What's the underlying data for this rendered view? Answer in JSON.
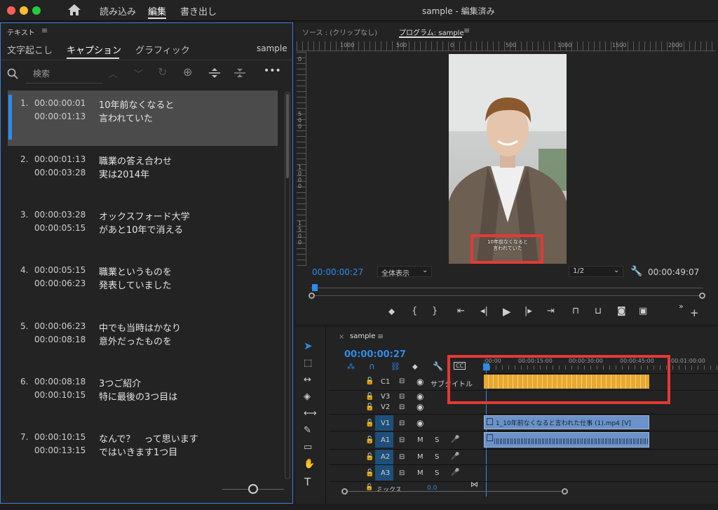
{
  "window": {
    "title": "sample - 編集済み"
  },
  "nav": {
    "import": "読み込み",
    "edit": "編集",
    "export": "書き出し"
  },
  "text_panel": {
    "title": "テキスト",
    "tabs": [
      "文字起こし",
      "キャプション",
      "グラフィック"
    ],
    "sequence": "sample",
    "search_placeholder": "検索",
    "captions": [
      {
        "num": "1.",
        "in": "00:00:00:01",
        "out": "00:00:01:13",
        "line1": "10年前なくなると",
        "line2": "言われていた"
      },
      {
        "num": "2.",
        "in": "00:00:01:13",
        "out": "00:00:03:28",
        "line1": "職業の答え合わせ",
        "line2": "実は2014年"
      },
      {
        "num": "3.",
        "in": "00:00:03:28",
        "out": "00:00:05:15",
        "line1": "オックスフォード大学",
        "line2": "があと10年で消える"
      },
      {
        "num": "4.",
        "in": "00:00:05:15",
        "out": "00:00:06:23",
        "line1": "職業というものを",
        "line2": "発表していました"
      },
      {
        "num": "5.",
        "in": "00:00:06:23",
        "out": "00:00:08:18",
        "line1": "中でも当時はかなり",
        "line2": "意外だったものを"
      },
      {
        "num": "6.",
        "in": "00:00:08:18",
        "out": "00:00:10:15",
        "line1": "3つご紹介",
        "line2": "特に最後の3つ目は"
      },
      {
        "num": "7.",
        "in": "00:00:10:15",
        "out": "00:00:13:15",
        "line1": "なんで？　って思います",
        "line2": "ではいきます1つ目"
      }
    ]
  },
  "monitor": {
    "source_tab": "ソース : (クリップなし)",
    "program_tab": "プログラム: sample",
    "ruler_labels": [
      "1000",
      "500",
      "0",
      "500",
      "1000",
      "1500",
      "2000"
    ],
    "vruler_labels": [
      "0",
      "500",
      "1000",
      "1500"
    ],
    "timecode": "00:00:00:27",
    "zoom": "全体表示",
    "quality": "1/2",
    "duration": "00:00:49:07",
    "subtitle_overlay": [
      "10年前なくなると",
      "言われていた"
    ]
  },
  "timeline": {
    "sequence_tab": "sample",
    "timecode": "00:00:00:27",
    "ruler": [
      ":00:00",
      "00:00:15:00",
      "00:00:30:00",
      "00:00:45:00",
      "00:01:00:00"
    ],
    "tracks": [
      {
        "name": "C1",
        "label": "サブタイトル"
      },
      {
        "name": "V3"
      },
      {
        "name": "V2"
      },
      {
        "name": "V1"
      },
      {
        "name": "A1"
      },
      {
        "name": "A2"
      },
      {
        "name": "A3"
      }
    ],
    "video_clip": "1_10年前なくなると言われた仕事 (1).mp4 [V]",
    "mix_label": "ミックス",
    "mix_value": "0.0"
  },
  "colors": {
    "accent": "#2d8ceb",
    "caption_clip": "#e8a92f",
    "video_clip": "#6b93c9",
    "highlight": "#e53935"
  }
}
